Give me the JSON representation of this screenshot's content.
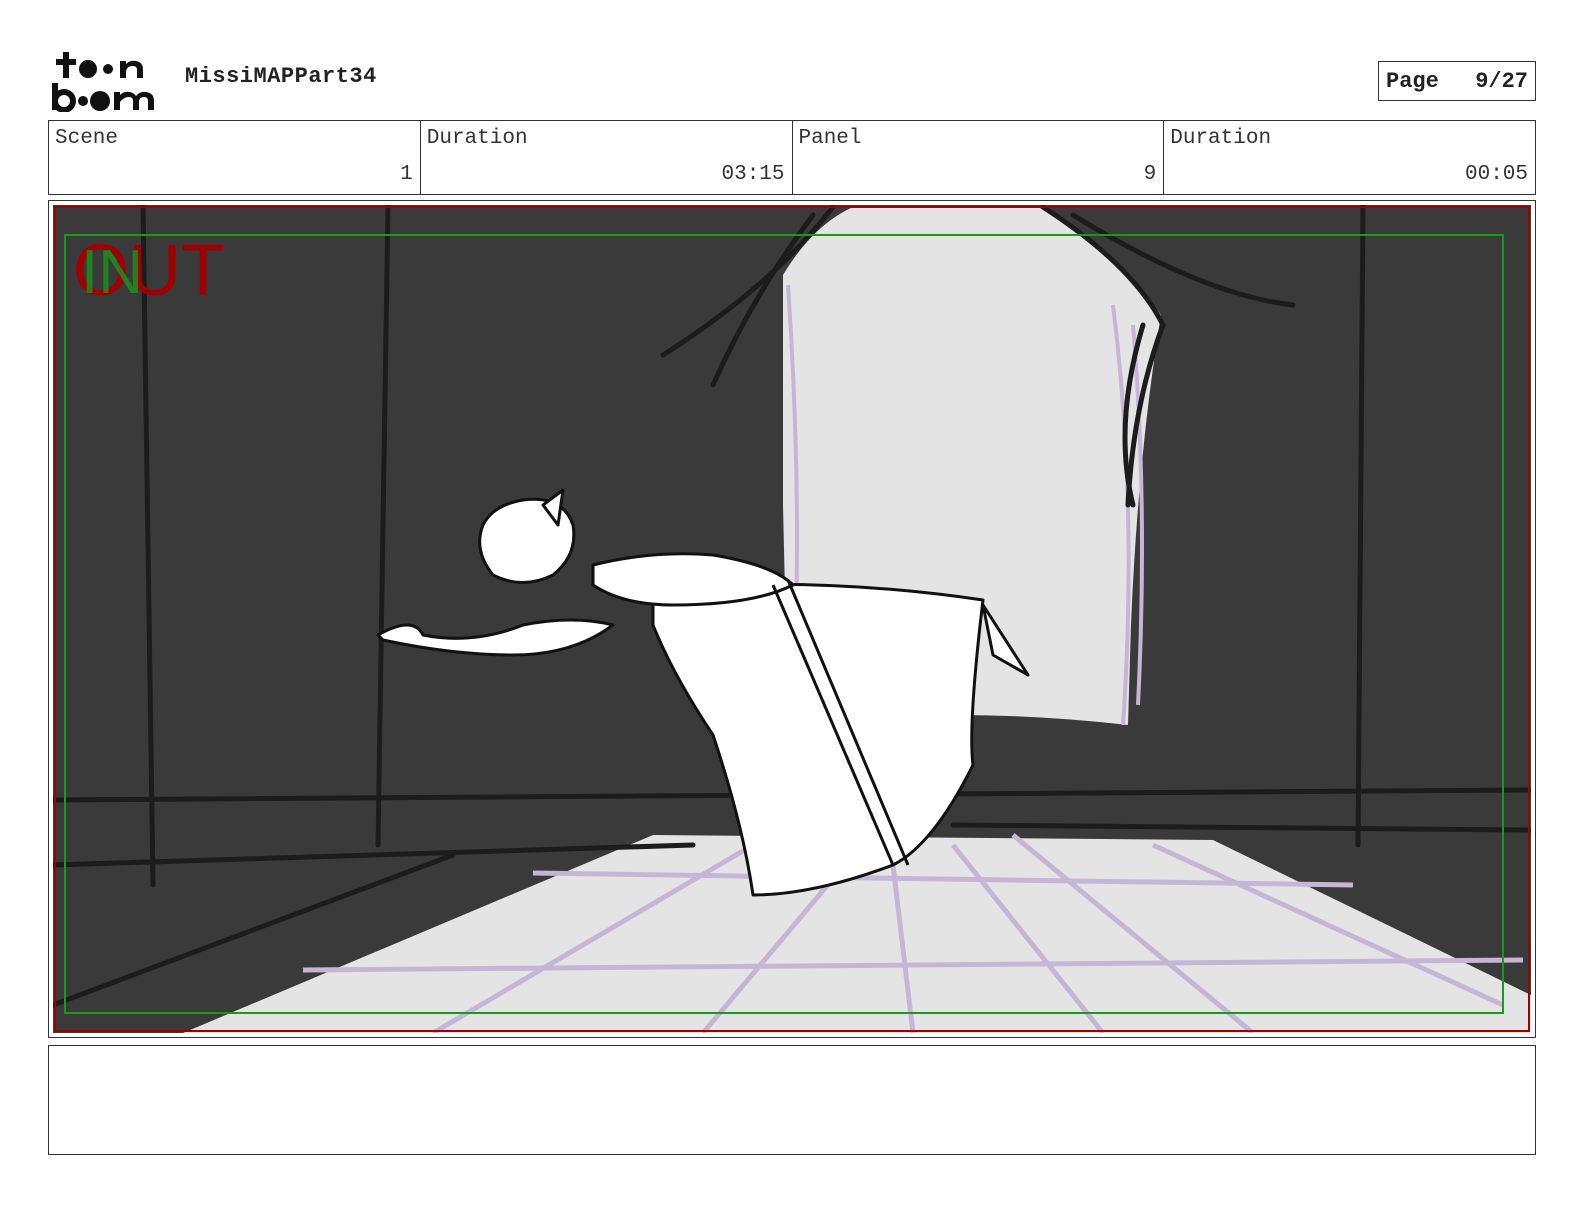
{
  "header": {
    "logo_text": "toon boom",
    "project_name": "MissiMAPPart34",
    "page_label": "Page",
    "page_value": "9/27"
  },
  "info": {
    "scene_label": "Scene",
    "scene_value": "1",
    "scene_duration_label": "Duration",
    "scene_duration_value": "03:15",
    "panel_label": "Panel",
    "panel_value": "9",
    "panel_duration_label": "Duration",
    "panel_duration_value": "00:05"
  },
  "panel": {
    "in_marker": "IN",
    "out_marker": "OUT"
  },
  "notes": {
    "text": ""
  },
  "colors": {
    "background_dark": "#3a3a3a",
    "window_light": "#e4e4e4",
    "floor_grid": "#c5b6d8",
    "out_marker": "#a00000",
    "in_marker": "#1a9a1a"
  }
}
